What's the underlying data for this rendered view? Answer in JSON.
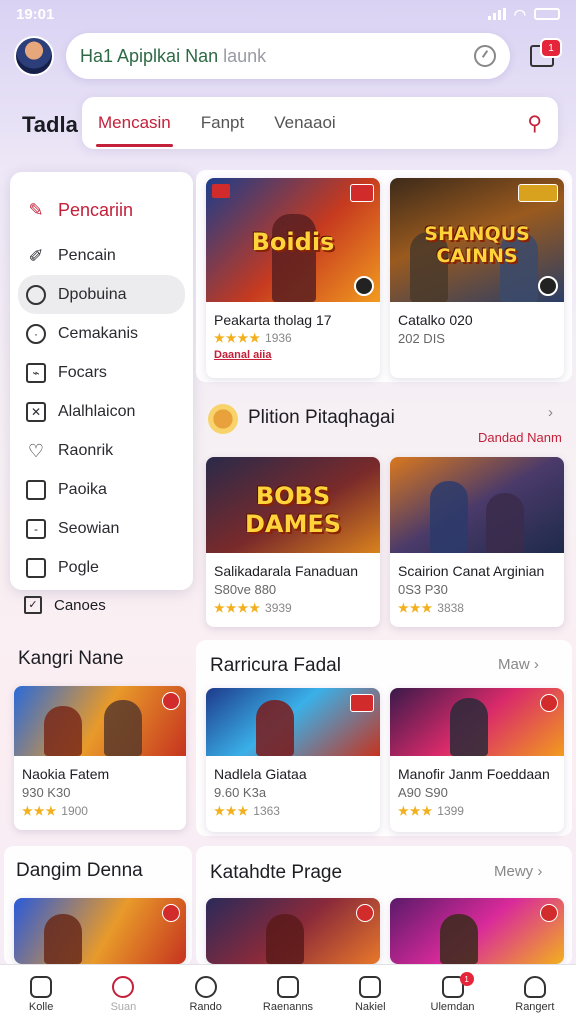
{
  "status": {
    "time": "19:01"
  },
  "topbar": {
    "search_value": "Ha1 Apiplkai Nan",
    "search_placeholder": "launk",
    "inbox_badge": "1"
  },
  "page_label": "Tadla",
  "tabs": [
    {
      "label": "Mencasin",
      "active": true
    },
    {
      "label": "Fanpt",
      "active": false
    },
    {
      "label": "Venaaoi",
      "active": false
    }
  ],
  "menu": [
    {
      "label": "Pencariin",
      "icon": "pencil-icon"
    },
    {
      "label": "Pencain",
      "icon": "brush-icon"
    },
    {
      "label": "Dpobuina",
      "icon": "search-icon"
    },
    {
      "label": "Cemakanis",
      "icon": "clock-icon"
    },
    {
      "label": "Focars",
      "icon": "image-icon"
    },
    {
      "label": "Alalhlaicon",
      "icon": "mail-icon"
    },
    {
      "label": "Raonrik",
      "icon": "heart-icon"
    },
    {
      "label": "Paoika",
      "icon": "square-icon"
    },
    {
      "label": "Seowian",
      "icon": "minus-square-icon"
    },
    {
      "label": "Pogle",
      "icon": "square-icon"
    }
  ],
  "cancel_label": "Canoes",
  "featured": [
    {
      "name": "Peakarta tholag 17",
      "stars": "★★★★",
      "count": "1936",
      "tag": "Daanal aiia",
      "art_title": "Boidis"
    },
    {
      "name": "Catalko 020",
      "meta": "202 DIS",
      "art_title": "SHANQUS CAINNS"
    }
  ],
  "section_popular": {
    "title": "Plition Pitaqhagai",
    "link": "Dandad Nanm"
  },
  "popular": [
    {
      "name": "Salikadarala Fanaduan",
      "meta": "S80ve 880",
      "stars": "★★★★",
      "count": "3939",
      "art_title": "BOBS DAMES"
    },
    {
      "name": "Scairion Canat Arginian",
      "meta": "0S3 P30",
      "stars": "★★★",
      "count": "3838",
      "art_title": ""
    }
  ],
  "section_left1": {
    "title": "Kangri Nane"
  },
  "left_card1": {
    "name": "Naokia Fatem",
    "meta": "930 K30",
    "stars": "★★★",
    "count": "1900"
  },
  "section_recent": {
    "title": "Rarricura Fadal",
    "more": "Maw"
  },
  "recent": [
    {
      "name": "Nadlela Giataa",
      "meta": "9.60 K3a",
      "stars": "★★★",
      "count": "1363"
    },
    {
      "name": "Manofir Janm Foeddaan",
      "meta": "A90 S90",
      "stars": "★★★",
      "count": "1399"
    }
  ],
  "section_left2": {
    "title": "Dangim Denna"
  },
  "section_bottom": {
    "title": "Katahdte Prage",
    "more": "Mewy"
  },
  "nav": [
    {
      "label": "Kolle",
      "icon": "home-icon"
    },
    {
      "label": "Suan",
      "icon": "search-icon",
      "active": true
    },
    {
      "label": "Rando",
      "icon": "users-icon"
    },
    {
      "label": "Raenanns",
      "icon": "camera-icon"
    },
    {
      "label": "Nakiel",
      "icon": "chat-icon"
    },
    {
      "label": "Ulemdan",
      "icon": "notification-icon",
      "badge": "1"
    },
    {
      "label": "Rangert",
      "icon": "profile-icon"
    }
  ]
}
